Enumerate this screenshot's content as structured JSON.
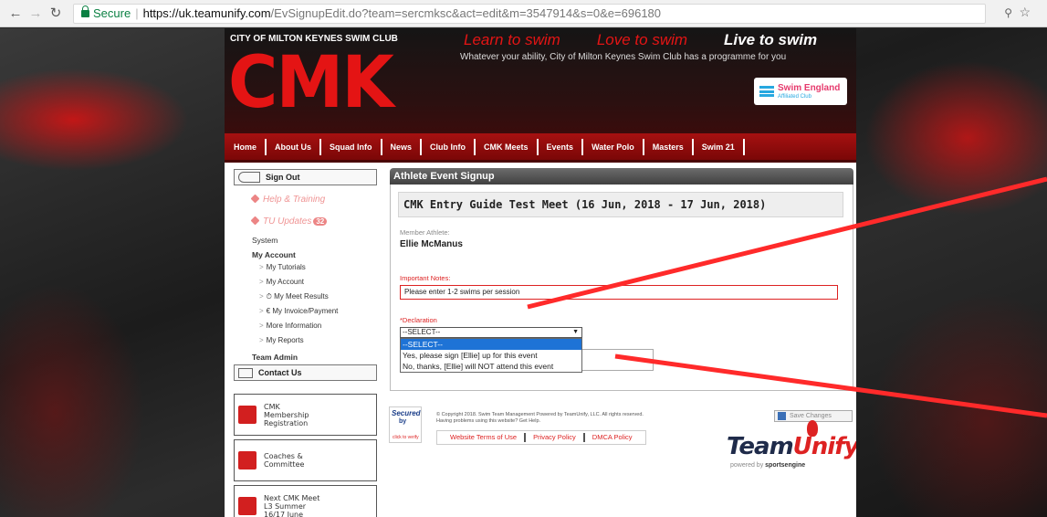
{
  "browser": {
    "secure_label": "Secure",
    "url_host": "https://uk.teamunify.com",
    "url_rest": "/EvSignupEdit.do?team=sercmksc&act=edit&m=3547914&s=0&e=696180"
  },
  "header": {
    "club_name": "CITY OF MILTON KEYNES SWIM CLUB",
    "logo": "CMK",
    "tagline": [
      "Learn to swim",
      "Love to swim",
      "Live to swim"
    ],
    "subtagline": "Whatever your ability, City of Milton Keynes Swim Club has a programme for you",
    "partner": "Swim England",
    "partner_sub": "Affiliated Club"
  },
  "nav": [
    "Home",
    "About Us",
    "Squad Info",
    "News",
    "Club Info",
    "CMK Meets",
    "Events",
    "Water Polo",
    "Masters",
    "Swim 21"
  ],
  "sidebar": {
    "sign_out": "Sign Out",
    "help_training": "Help & Training",
    "tu_updates": "TU Updates",
    "tu_updates_count": "32",
    "system": "System",
    "my_account": "My Account",
    "my_tutorials": "My Tutorials",
    "my_account_link": "My Account",
    "my_meet_results": "My Meet Results",
    "my_invoice": "€ My Invoice/Payment",
    "more_information": "More Information",
    "my_reports": "My Reports",
    "team_admin": "Team Admin",
    "contact_us": "Contact Us",
    "promo_membership": "CMK\nMembership\nRegistration",
    "promo_coaches": "Coaches &\nCommittee",
    "promo_next_meet": "Next CMK Meet\nL3 Summer\n16/17 June"
  },
  "main": {
    "panel_title": "Athlete Event Signup",
    "meet_title": "CMK Entry Guide Test Meet (16 Jun, 2018 - 17 Jun, 2018)",
    "member_label": "Member Athlete:",
    "athlete_name": "Ellie McManus",
    "notes_label": "Important Notes:",
    "notes_value": "Please enter 1-2 swims per session",
    "declaration_label": "*Declaration",
    "declaration_value": "--SELECT--",
    "declaration_options": [
      "--SELECT--",
      "Yes, please sign [Ellie] up for this event",
      "No, thanks, [Ellie] will NOT attend this event"
    ],
    "save_label": "Save Changes"
  },
  "footer": {
    "secured": "Secured",
    "secured_by": "by",
    "click_verify": "click to verify",
    "copyright": "© Copyright 2018. Swim Team Management Powered by TeamUnify, LLC. All rights reserved.",
    "help_text": "Having problems using this website? Get Help.",
    "links": [
      "Website Terms of Use",
      "Privacy Policy",
      "DMCA Policy"
    ],
    "tu_team": "Team",
    "tu_unify": "Unify",
    "tu_powered": "powered by",
    "tu_sports": "sportsengine"
  }
}
